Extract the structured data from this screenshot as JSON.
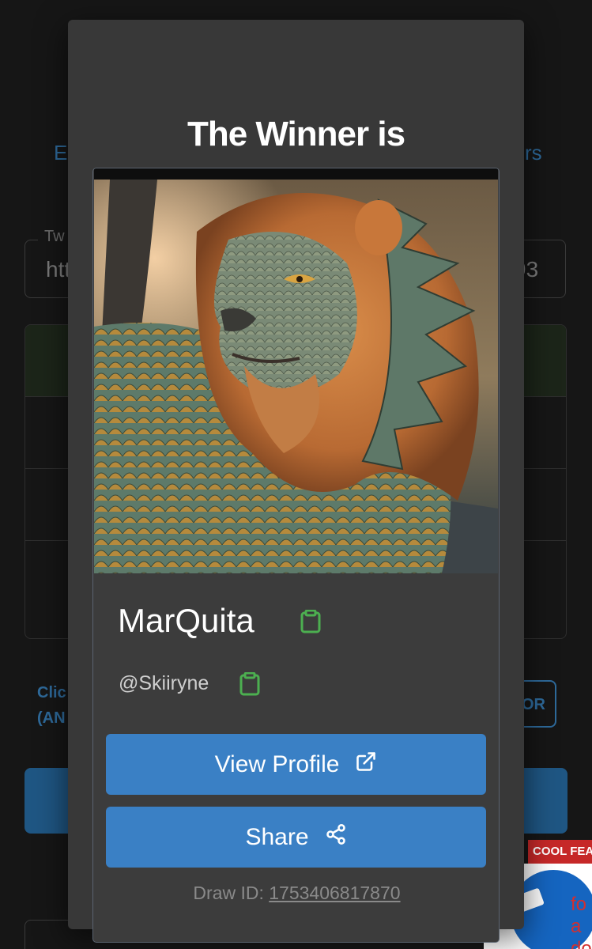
{
  "background": {
    "tab_left_fragment": "E",
    "tab_right_fragment": "rs",
    "field_legend_fragment": "Tw",
    "field_value_left_fragment": "htt",
    "field_value_right_fragment": "93",
    "click_text_line1": "Clic",
    "click_text_line2": "(AN",
    "or_button_fragment": "OR"
  },
  "ad": {
    "badge": "COOL FEA",
    "text_line1": "fo",
    "text_line2": "a do"
  },
  "modal": {
    "title": "The Winner is",
    "winner": {
      "name": "MarQuita",
      "handle": "@Skiiryne",
      "image_alt": "Lion with dragon scales avatar"
    },
    "view_profile_label": "View Profile",
    "share_label": "Share",
    "draw_id_label": "Draw ID:",
    "draw_id_value": "1753406817870"
  },
  "colors": {
    "accent_button": "#3a80c5",
    "copy_icon": "#4caf50",
    "modal_bg": "#383838"
  },
  "icons": {
    "copy": "clipboard-icon",
    "external": "external-link-icon",
    "share": "share-icon"
  }
}
